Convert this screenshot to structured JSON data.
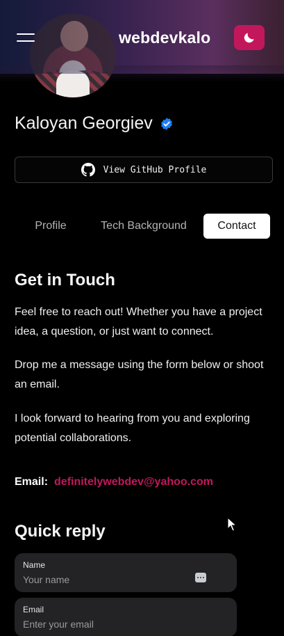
{
  "header": {
    "brand": "webdevkalo",
    "menu_icon": "hamburger-menu-icon",
    "theme_icon": "moon-icon",
    "theme_button_color": "#c2185b"
  },
  "profile": {
    "name": "Kaloyan Georgiev",
    "verified_icon": "verified-badge-icon",
    "verified_color": "#1d7ff2",
    "github_button_label": "View GitHub Profile",
    "github_icon": "github-icon"
  },
  "tabs": [
    {
      "label": "Profile",
      "active": false
    },
    {
      "label": "Tech Background",
      "active": false
    },
    {
      "label": "Contact",
      "active": true
    }
  ],
  "contact": {
    "heading": "Get in Touch",
    "paragraphs": [
      "Feel free to reach out! Whether you have a project idea, a question, or just want to connect.",
      "Drop me a message using the form below or shoot an email.",
      "I look forward to hearing from you and exploring potential collaborations."
    ],
    "email_label": "Email:",
    "email_value": "definitelywebdev@yahoo.com",
    "accent_color": "#c2185b"
  },
  "quick_reply": {
    "heading": "Quick reply",
    "fields": [
      {
        "label": "Name",
        "placeholder": "Your name"
      },
      {
        "label": "Email",
        "placeholder": "Enter your email"
      }
    ]
  }
}
